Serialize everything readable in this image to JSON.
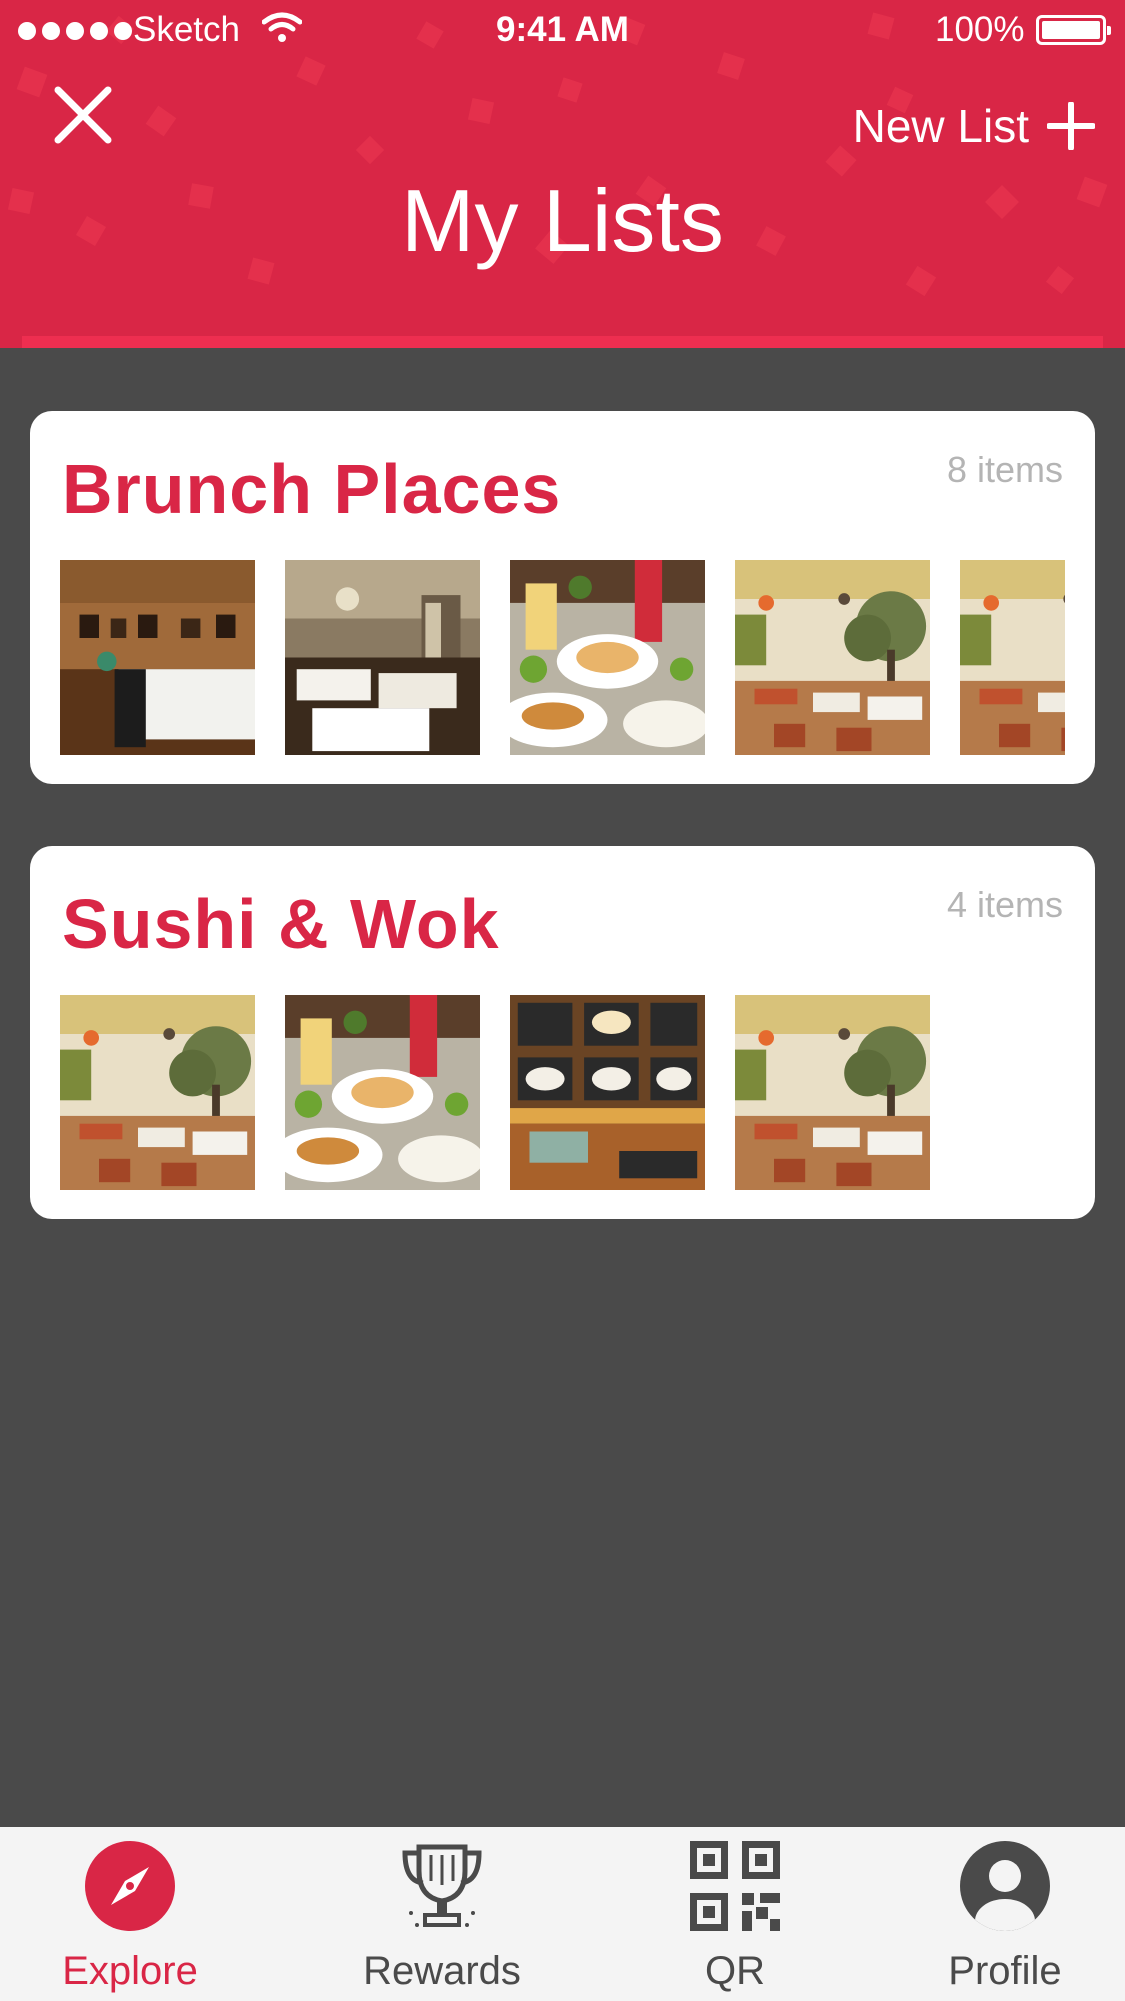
{
  "status_bar": {
    "carrier": "Sketch",
    "time": "9:41 AM",
    "battery": "100%"
  },
  "header": {
    "title": "My Lists",
    "new_list_label": "New List",
    "close_icon": "close-icon",
    "add_icon": "plus-icon"
  },
  "lists": [
    {
      "name": "Brunch Places",
      "count": "8 items",
      "thumbnails": [
        "restaurant-wood-interior",
        "restaurant-white-tables",
        "brunch-food-spread",
        "restaurant-tree-interior",
        "restaurant-tree-interior"
      ]
    },
    {
      "name": "Sushi & Wok",
      "count": "4 items",
      "thumbnails": [
        "restaurant-tree-interior",
        "brunch-food-spread",
        "food-counter-menu-boards",
        "restaurant-tree-interior"
      ]
    }
  ],
  "tabs": [
    {
      "label": "Explore",
      "icon": "compass-icon",
      "active": true
    },
    {
      "label": "Rewards",
      "icon": "trophy-icon",
      "active": false
    },
    {
      "label": "QR",
      "icon": "qr-code-icon",
      "active": false
    },
    {
      "label": "Profile",
      "icon": "user-icon",
      "active": false
    }
  ],
  "colors": {
    "brand": "#d92646",
    "background": "#4a4a4a",
    "tabbar": "#f4f4f4",
    "muted_text": "#b4b4b4"
  }
}
